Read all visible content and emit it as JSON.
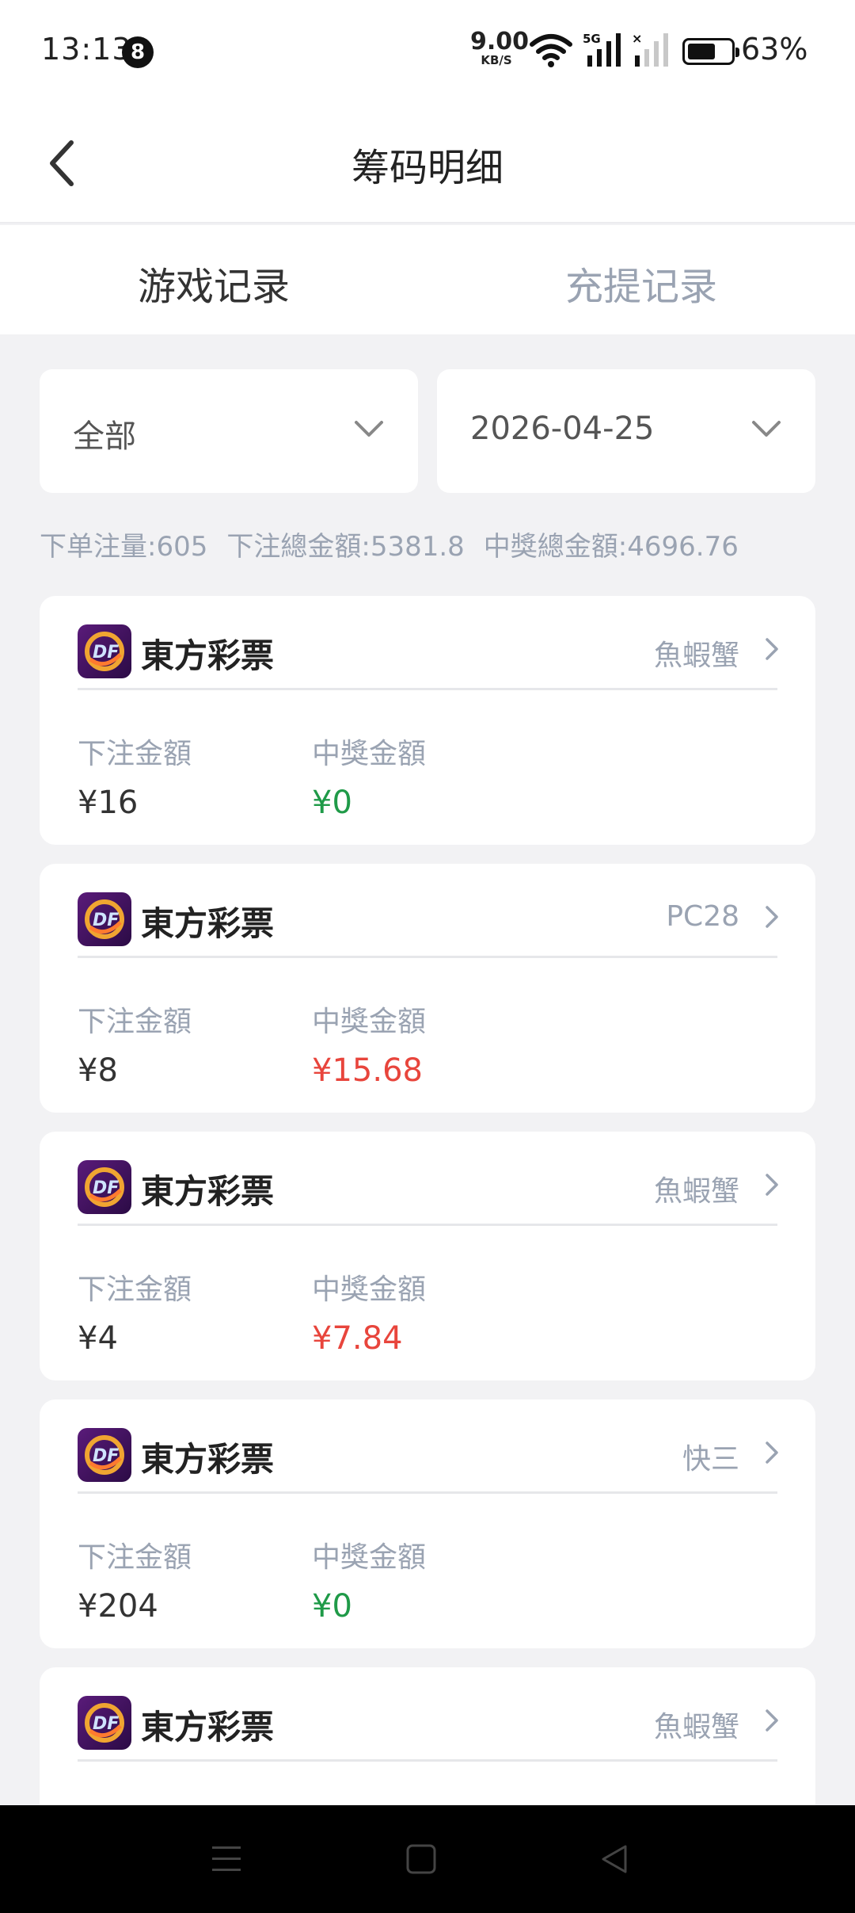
{
  "status_bar": {
    "time": "13:13",
    "notification_count": "8",
    "net_speed": "9.00",
    "net_speed_unit": "KB/S",
    "battery": "63%"
  },
  "header": {
    "title": "筹码明细"
  },
  "tabs": [
    {
      "label": "游戏记录",
      "active": true
    },
    {
      "label": "充提记录",
      "active": false
    }
  ],
  "filters": {
    "type": "全部",
    "date": "2026-04-25"
  },
  "summary": {
    "order_count": "下单注量:605",
    "bet_total": "下注總金額:5381.8",
    "win_total": "中獎總金額:4696.76"
  },
  "records": [
    {
      "name": "東方彩票",
      "game": "魚蝦蟹",
      "bet_label": "下注金額",
      "win_label": "中獎金額",
      "bet": "¥16",
      "win": "¥0",
      "win_color": "#1f9a48"
    },
    {
      "name": "東方彩票",
      "game": "PC28",
      "bet_label": "下注金額",
      "win_label": "中獎金額",
      "bet": "¥8",
      "win": "¥15.68",
      "win_color": "#e8453c"
    },
    {
      "name": "東方彩票",
      "game": "魚蝦蟹",
      "bet_label": "下注金額",
      "win_label": "中獎金額",
      "bet": "¥4",
      "win": "¥7.84",
      "win_color": "#e8453c"
    },
    {
      "name": "東方彩票",
      "game": "快三",
      "bet_label": "下注金額",
      "win_label": "中獎金額",
      "bet": "¥204",
      "win": "¥0",
      "win_color": "#1f9a48"
    },
    {
      "name": "東方彩票",
      "game": "魚蝦蟹"
    }
  ],
  "icons": {
    "logo": "df-lottery-logo-icon",
    "back": "chevron-left-icon",
    "dropdown": "chevron-down-icon",
    "detail": "chevron-right-icon"
  }
}
